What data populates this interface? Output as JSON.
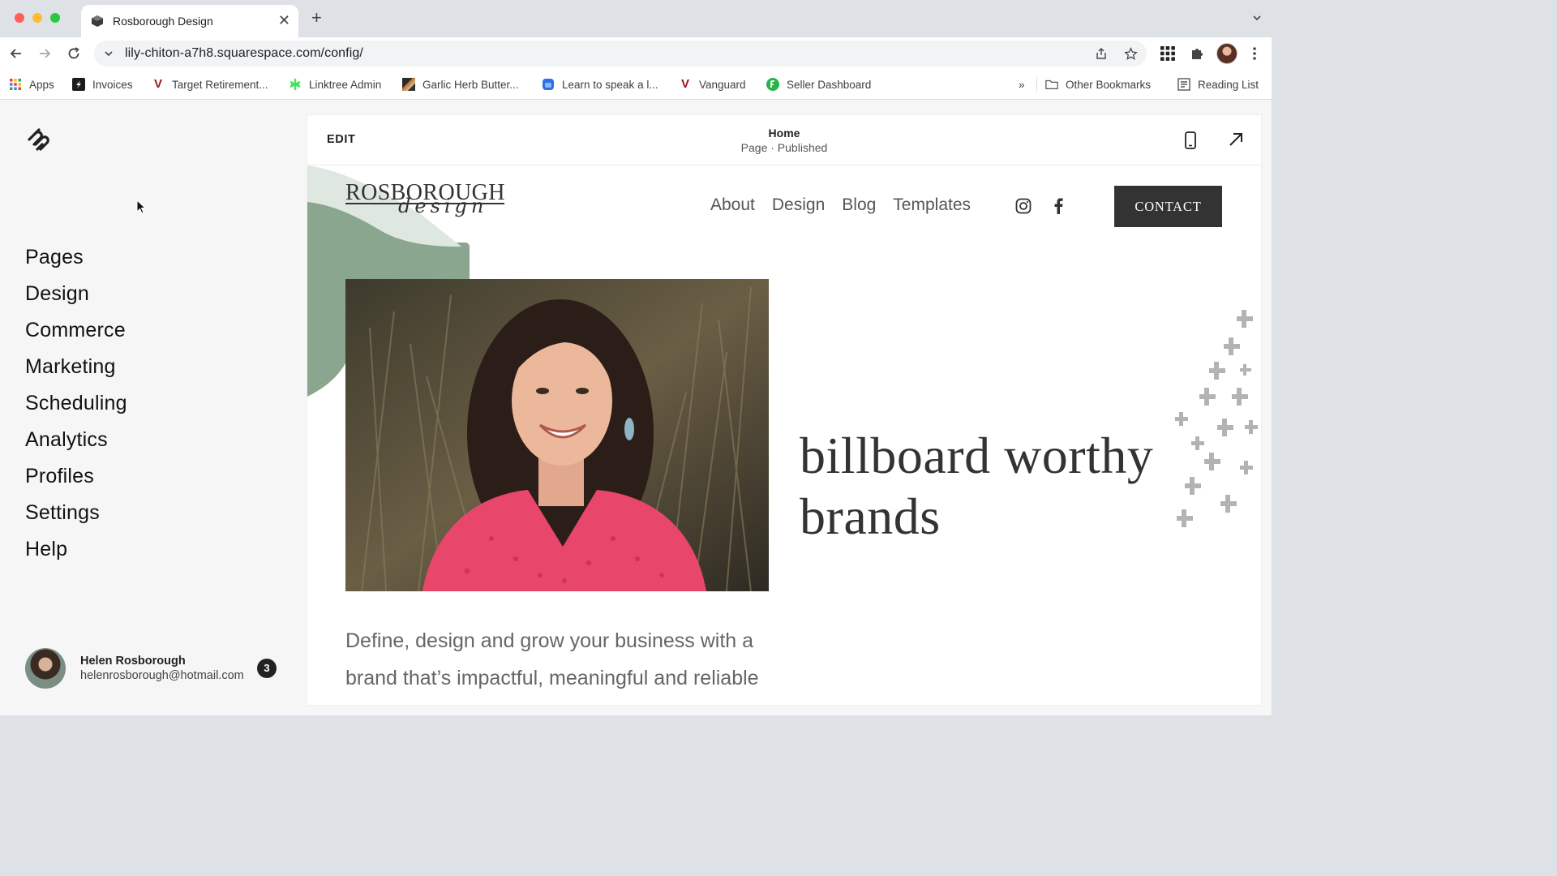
{
  "browser": {
    "tab_title": "Rosborough Design",
    "url": "lily-chiton-a7h8.squarespace.com/config/",
    "bookmarks": [
      {
        "label": "Apps",
        "icon": "apps-grid-icon"
      },
      {
        "label": "Invoices",
        "icon": "invoices-icon"
      },
      {
        "label": "Target Retirement...",
        "icon": "vanguard-v-icon"
      },
      {
        "label": "Linktree Admin",
        "icon": "linktree-icon"
      },
      {
        "label": "Garlic Herb Butter...",
        "icon": "recipe-thumb-icon"
      },
      {
        "label": "Learn to speak a l...",
        "icon": "duo-icon"
      },
      {
        "label": "Vanguard",
        "icon": "vanguard-v-icon"
      },
      {
        "label": "Seller Dashboard",
        "icon": "seller-icon"
      }
    ],
    "overflow": "»",
    "other_bookmarks": "Other Bookmarks",
    "reading_list": "Reading List"
  },
  "sidebar": {
    "menu": [
      "Pages",
      "Design",
      "Commerce",
      "Marketing",
      "Scheduling",
      "Analytics",
      "Profiles",
      "Settings",
      "Help"
    ],
    "user": {
      "name": "Helen Rosborough",
      "email": "helenrosborough@hotmail.com",
      "notifications": "3"
    }
  },
  "editor": {
    "edit_label": "EDIT",
    "page_title": "Home",
    "page_status": "Page · Published"
  },
  "site": {
    "logo_main": "ROSBOROUGH",
    "logo_script": "design",
    "nav": [
      "About",
      "Design",
      "Blog",
      "Templates"
    ],
    "contact": "CONTACT",
    "headline": "billboard worthy\nbrands",
    "tagline": "Define, design and grow your business with a brand that’s impactful, meaningful and reliable",
    "colors": {
      "accent_green": "#8ba68e",
      "button_dark": "#333333",
      "shirt_pink": "#e8466b"
    }
  }
}
